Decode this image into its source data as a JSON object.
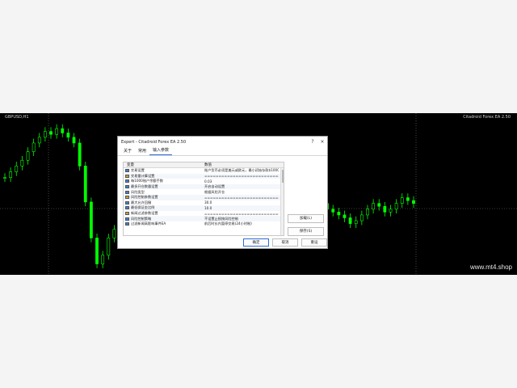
{
  "chart": {
    "symbol_label": "GBPUSD,H1",
    "ea_label": "Citadroid Forex EA 2.50",
    "watermark": "www.mt4.shop",
    "colors": {
      "background": "#000000",
      "candle": "#00ff00",
      "grid": "#7a7a7a"
    },
    "price_series": [
      0.62,
      0.66,
      0.7,
      0.74,
      0.8,
      0.86,
      0.9,
      0.94,
      0.92,
      0.96,
      0.93,
      0.9,
      0.86,
      0.7,
      0.45,
      0.2,
      0.02,
      0.08,
      0.2,
      0.26,
      0.3,
      0.28,
      0.34,
      0.38,
      0.36,
      0.42,
      0.44,
      0.4,
      0.38,
      0.42,
      0.44,
      0.46,
      0.5,
      0.48,
      0.44,
      0.46,
      0.48,
      0.5,
      0.46,
      0.4,
      0.44,
      0.52,
      0.58,
      0.54,
      0.5,
      0.52,
      0.48,
      0.46,
      0.42,
      0.4,
      0.44,
      0.38,
      0.36,
      0.42,
      0.46,
      0.44,
      0.4,
      0.38,
      0.36,
      0.34,
      0.3,
      0.32,
      0.36,
      0.4,
      0.44,
      0.42,
      0.38,
      0.4,
      0.44,
      0.48,
      0.46,
      0.44
    ]
  },
  "dialog": {
    "title": "Expert - Citadroid Forex EA 2.50",
    "help_icon": "?",
    "close_icon": "×",
    "tabs": [
      {
        "label": "关于",
        "active": false
      },
      {
        "label": "常用",
        "active": false
      },
      {
        "label": "输入参数",
        "active": true
      }
    ],
    "grid": {
      "headers": [
        "变量",
        "数值"
      ],
      "rows": [
        {
          "icon": "val",
          "name": "交易设置",
          "value": "账户货币必须是美元或欧元，最小初始存款$1000..."
        },
        {
          "icon": "sep",
          "name": "交易量计算设置",
          "value": "==========================="
        },
        {
          "icon": "val",
          "name": "每1000账户余额手数",
          "value": "0.03"
        },
        {
          "icon": "val",
          "name": "最多开仓数量设置",
          "value": "开启自动设置"
        },
        {
          "icon": "val",
          "name": "风险类型",
          "value": "根据风险开仓"
        },
        {
          "icon": "sep",
          "name": "风险控制参数设置",
          "value": "==========================="
        },
        {
          "icon": "val",
          "name": "最大允许回撤",
          "value": "30.0"
        },
        {
          "icon": "val",
          "name": "最低保证金比例",
          "value": "10.0"
        },
        {
          "icon": "sep",
          "name": "新闻过滤参数设置",
          "value": "==========================="
        },
        {
          "icon": "val",
          "name": "风险控制策略",
          "value": "不设置止损按风险控制"
        },
        {
          "icon": "val",
          "name": "过滤新闻高影响事件EA",
          "value": "前后时长内暂停交易(24小时制)"
        }
      ]
    },
    "buttons": {
      "load": "加载(L)",
      "save": "保存(S)",
      "ok": "确定",
      "cancel": "取消",
      "reset": "重设"
    }
  }
}
